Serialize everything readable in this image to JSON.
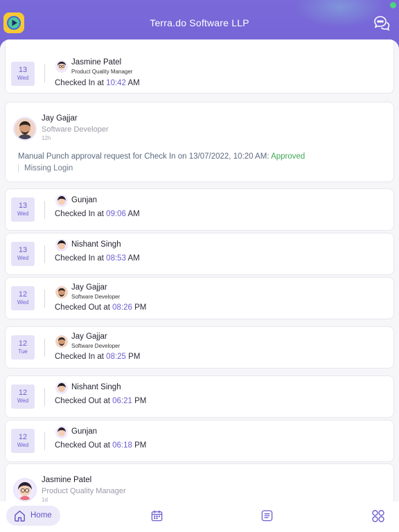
{
  "header": {
    "title": "Terra.do Software LLP",
    "logo_icon": "play-logo-icon",
    "chat_icon": "chat-bubbles-icon",
    "accent": "#7565d6"
  },
  "feed": [
    {
      "type": "punch",
      "day": "13",
      "weekday": "Wed",
      "name": "Jasmine Patel",
      "role": "Product Quality Manager",
      "action": "Checked In at",
      "time": "10:42",
      "ampm": "AM"
    },
    {
      "type": "request",
      "name": "Jay Gajjar",
      "role": "Software Developer",
      "age": "12h",
      "message": "Manual Punch approval request for Check In on 13/07/2022, 10:20 AM:",
      "status": "Approved",
      "reason": "Missing Login"
    },
    {
      "type": "punch",
      "day": "13",
      "weekday": "Wed",
      "name": "Gunjan",
      "role": "",
      "action": "Checked In at",
      "time": "09:06",
      "ampm": "AM"
    },
    {
      "type": "punch",
      "day": "13",
      "weekday": "Wed",
      "name": "Nishant Singh",
      "role": "",
      "action": "Checked In at",
      "time": "08:53",
      "ampm": "AM"
    },
    {
      "type": "punch",
      "day": "12",
      "weekday": "Wed",
      "name": "Jay Gajjar",
      "role": "Software Developer",
      "action": "Checked Out at",
      "time": "08:26",
      "ampm": "PM"
    },
    {
      "type": "punch",
      "day": "12",
      "weekday": "Tue",
      "name": "Jay Gajjar",
      "role": "Software Developer",
      "action": "Checked In at",
      "time": "08:25",
      "ampm": "PM"
    },
    {
      "type": "punch",
      "day": "12",
      "weekday": "Wed",
      "name": "Nishant Singh",
      "role": "",
      "action": "Checked Out at",
      "time": "06:21",
      "ampm": "PM"
    },
    {
      "type": "punch",
      "day": "12",
      "weekday": "Wed",
      "name": "Gunjan",
      "role": "",
      "action": "Checked Out at",
      "time": "06:18",
      "ampm": "PM"
    },
    {
      "type": "request",
      "name": "Jasmine Patel",
      "role": "Product Quality Manager",
      "age": "1d"
    }
  ],
  "nav": {
    "home_label": "Home",
    "items": [
      "home-icon",
      "calendar-icon",
      "list-icon",
      "grid-icon"
    ]
  }
}
